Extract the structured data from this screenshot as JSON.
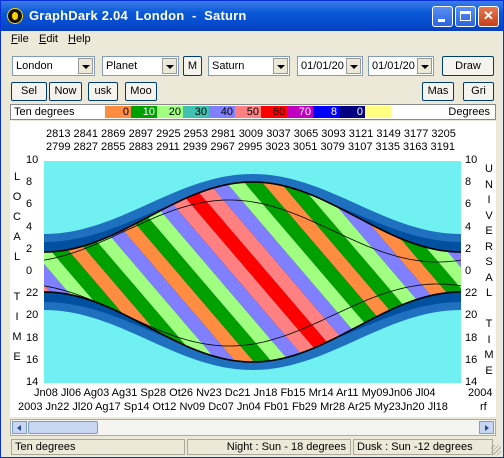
{
  "window": {
    "title": "GraphDark 2.04  London  -  Saturn",
    "close_glyph": "✕"
  },
  "menu": {
    "items": [
      {
        "label": "File",
        "access": "F",
        "rest": "ile"
      },
      {
        "label": "Edit",
        "access": "E",
        "rest": "dit"
      },
      {
        "label": "Help",
        "access": "H",
        "rest": "elp"
      }
    ]
  },
  "toolbar": {
    "location": "London",
    "category": "Planet",
    "m_button": "M",
    "object": "Saturn",
    "start_date": "01/01/20",
    "end_date": "01/01/20",
    "draw_button": "Draw"
  },
  "toolbar2": {
    "sel": "Sel",
    "now": "Now",
    "usk": "usk",
    "moo": "Moo",
    "mas": "Mas",
    "gri": "Gri"
  },
  "legend": {
    "left_label": "Ten degrees",
    "right_label": "Degrees",
    "swatches": [
      {
        "label": "0",
        "color": "#ff8c40"
      },
      {
        "label": "10",
        "color": "#00a000"
      },
      {
        "label": "20",
        "color": "#a0ff80"
      },
      {
        "label": "30",
        "color": "#40c0b0"
      },
      {
        "label": "40",
        "color": "#8080ff"
      },
      {
        "label": "50",
        "color": "#ff8080"
      },
      {
        "label": "60",
        "color": "#ff0000"
      },
      {
        "label": "70",
        "color": "#c000c0"
      },
      {
        "label": "8",
        "color": "#0000ff"
      },
      {
        "label": "0",
        "color": "#000080"
      },
      {
        "label": "",
        "color": "#ffff80"
      }
    ]
  },
  "plot": {
    "top_ticks_row1": "2813 2841 2869 2897 2925 2953 2981 3009 3037 3065 3093 3121 3149 3177 3205",
    "top_ticks_row2": "2799 2827 2855 2883 2911 2939 2967 2995 3023 3051 3079 3107 3135 3163 3191",
    "left_title": [
      "L",
      "O",
      "C",
      "A",
      "L",
      "",
      "T",
      "I",
      "M",
      "E"
    ],
    "right_title": [
      "U",
      "N",
      "I",
      "V",
      "E",
      "R",
      "S",
      "A",
      "L",
      "",
      "T",
      "I",
      "M",
      "E"
    ],
    "left_ticks": [
      "10",
      "8",
      "6",
      "4",
      "2",
      "0",
      "22",
      "20",
      "18",
      "16",
      "14"
    ],
    "right_ticks": [
      "10",
      "8",
      "6",
      "4",
      "2",
      "0",
      "22",
      "20",
      "18",
      "16",
      "14"
    ],
    "bottom_ticks_row1": "Jn08  Jl06   Ag03 Ag31 Sp28 Ot26  Nv23 Dc21 Jn18  Fb15  Mr14  Ar11   My09Jn06  Jl04",
    "bottom_ticks_row1_end": "2004",
    "bottom_ticks_row2": "2003 Jn22 Jl20   Ag17 Sp14 Ot12  Nv09 Dc07 Jn04  Fb01 Fb29 Mr28 Ar25  My23Jn20 Jl18",
    "bottom_ticks_row2_end": "rf",
    "colors": {
      "sky": "#70f0f0",
      "twilight_outer": "#2070c0",
      "twilight_inner": "#0050a0",
      "night": "#000850",
      "band_a": "#ff8c40",
      "band_b": "#00a000",
      "band_c": "#a0ff80",
      "band_d": "#8080ff",
      "band_e": "#ff8080",
      "band_f": "#ff0000"
    }
  },
  "status": {
    "left": "Ten degrees",
    "middle": "Night : Sun - 18 degrees",
    "right": "Dusk : Sun -12 degrees"
  }
}
